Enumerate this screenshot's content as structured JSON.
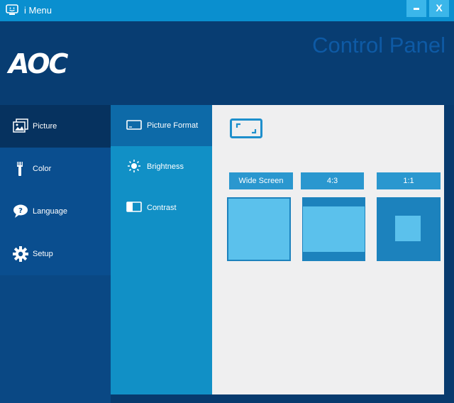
{
  "window": {
    "title": "i Menu",
    "minimize_label": "",
    "close_label": "X"
  },
  "header": {
    "logo": "AOC",
    "panel_title": "Control Panel"
  },
  "sidebar": {
    "items": [
      {
        "label": "Picture",
        "icon": "picture-icon",
        "active": true
      },
      {
        "label": "Color",
        "icon": "color-brush-icon",
        "active": false
      },
      {
        "label": "Language",
        "icon": "language-bubble-icon",
        "active": false
      },
      {
        "label": "Setup",
        "icon": "gear-icon",
        "active": false
      }
    ]
  },
  "subnav": {
    "items": [
      {
        "label": "Picture Format",
        "icon": "picture-format-icon",
        "active": true
      },
      {
        "label": "Brightness",
        "icon": "sun-icon",
        "active": false
      },
      {
        "label": "Contrast",
        "icon": "contrast-icon",
        "active": false
      }
    ]
  },
  "content": {
    "section_icon": "aspect-ratio-icon",
    "formats": [
      {
        "label": "Wide Screen"
      },
      {
        "label": "4:3"
      },
      {
        "label": "1:1"
      }
    ]
  },
  "colors": {
    "titlebar": "#0a8fcf",
    "header": "#083d72",
    "accent": "#2a97cf",
    "preview_fill": "#5bc1ec",
    "preview_border": "#1c82bd"
  }
}
